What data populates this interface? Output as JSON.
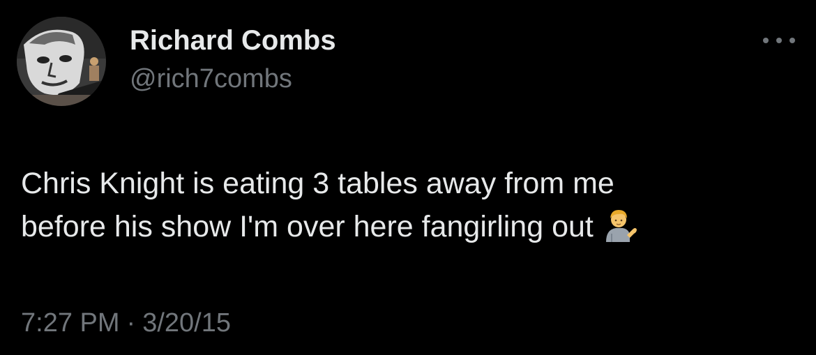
{
  "tweet": {
    "author": {
      "display_name": "Richard Combs",
      "handle": "@rich7combs",
      "avatar_icon": "profile-photo-icon"
    },
    "menu_icon": "more-options-icon",
    "text_lines": [
      "Chris Knight is eating 3 tables away from me",
      "before his show I'm over here fangirling out"
    ],
    "emoji": "person-tipping-hand-emoji",
    "time": "7:27 PM",
    "separator": "·",
    "date": "3/20/15"
  },
  "colors": {
    "background": "#000000",
    "primary_text": "#e7e9ea",
    "secondary_text": "#71767b"
  }
}
